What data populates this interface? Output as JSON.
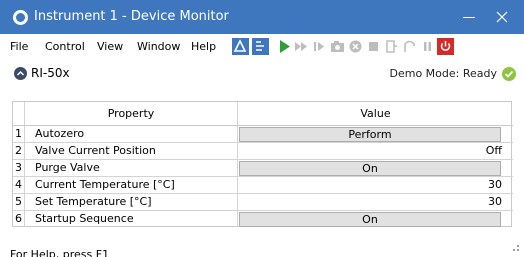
{
  "window": {
    "title": "Instrument 1 - Device Monitor"
  },
  "menu": {
    "items": [
      {
        "label": "File"
      },
      {
        "label": "Control"
      },
      {
        "label": "View"
      },
      {
        "label": "Window"
      },
      {
        "label": "Help"
      }
    ]
  },
  "toolbar": {
    "icons": [
      "instrument-icon",
      "method-icon",
      "play-icon",
      "fast-forward-icon",
      "step-icon",
      "camera-icon",
      "cancel-icon",
      "stop-icon",
      "pump-icon",
      "valve-icon",
      "pause-icon",
      "power-icon"
    ],
    "colors": {
      "play": "#2f9e3a",
      "disabled": "#bdbdbd",
      "power": "#d42a2a",
      "accent": "#3f77bf"
    }
  },
  "device": {
    "name": "RI-50x",
    "status": "Demo Mode: Ready",
    "status_color": "#8dc63f"
  },
  "table": {
    "headers": {
      "property": "Property",
      "value": "Value"
    },
    "rows": [
      {
        "index": "1",
        "property": "Autozero",
        "value": "Perform",
        "value_type": "button"
      },
      {
        "index": "2",
        "property": "Valve Current Position",
        "value": "Off",
        "value_type": "text"
      },
      {
        "index": "3",
        "property": "Purge Valve",
        "value": "On",
        "value_type": "button"
      },
      {
        "index": "4",
        "property": "Current Temperature [°C]",
        "value": "30",
        "value_type": "text"
      },
      {
        "index": "5",
        "property": "Set Temperature [°C]",
        "value": "30",
        "value_type": "text"
      },
      {
        "index": "6",
        "property": "Startup Sequence",
        "value": "On",
        "value_type": "button"
      }
    ]
  },
  "statusbar": {
    "help": "For Help, press F1"
  }
}
